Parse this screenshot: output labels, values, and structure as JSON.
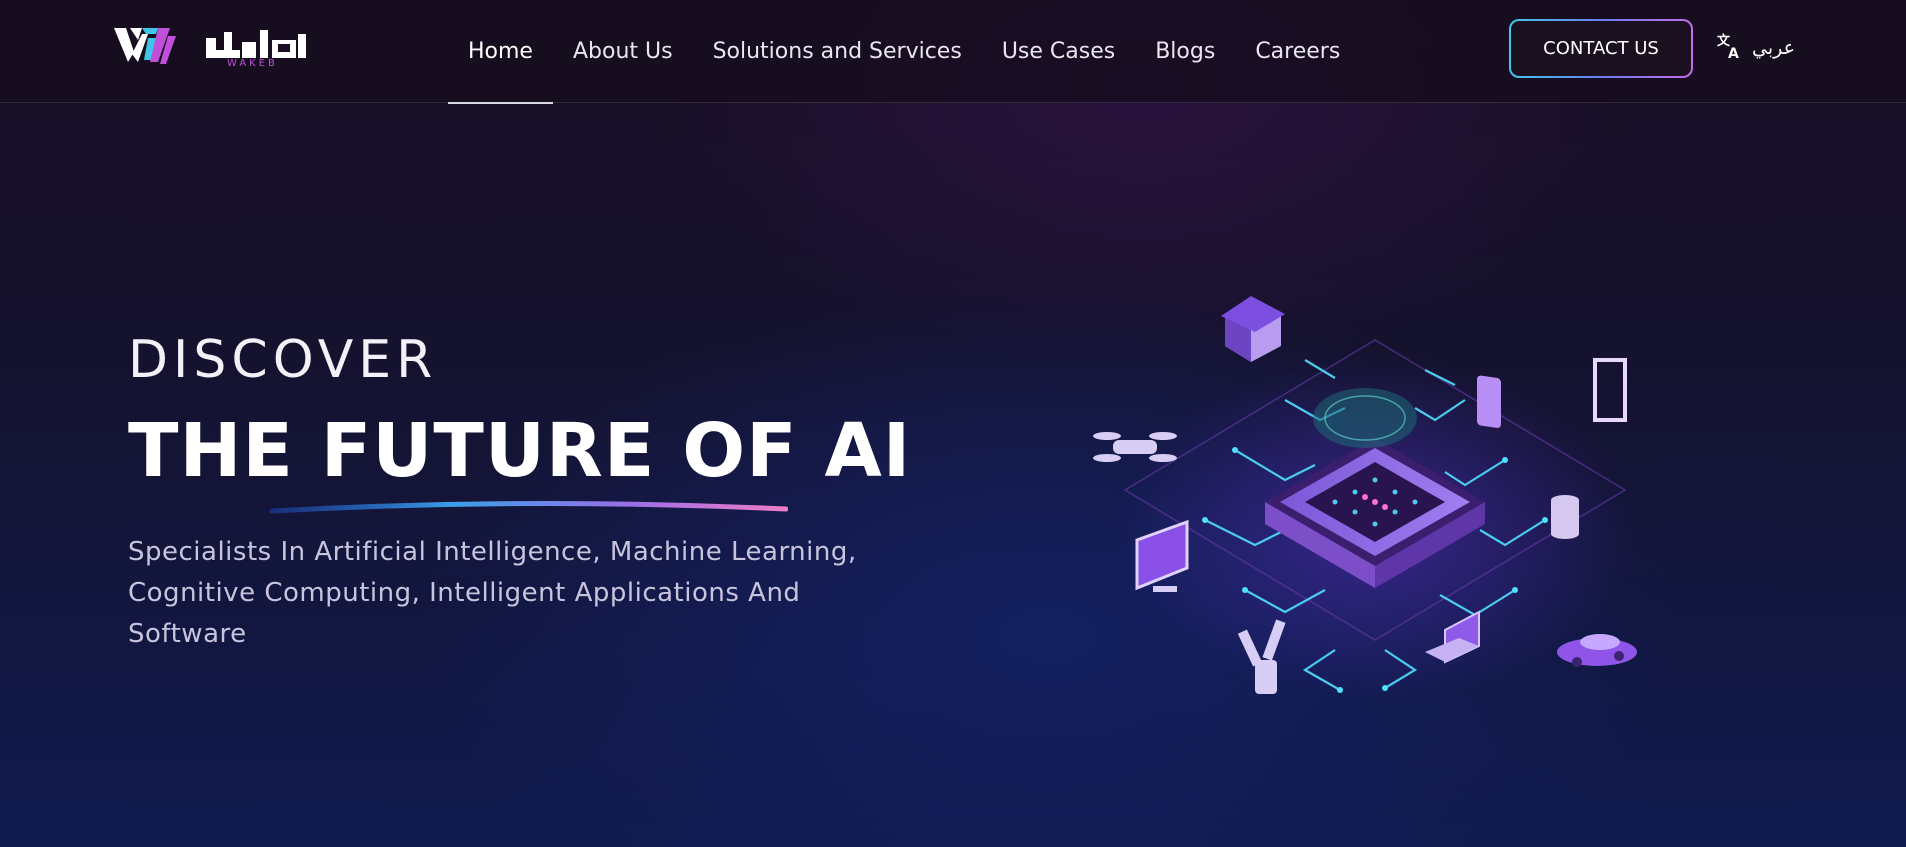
{
  "brand": {
    "logo_word": "WAKEB",
    "logo_arabic": "واكب"
  },
  "nav": {
    "items": [
      {
        "label": "Home",
        "active": true
      },
      {
        "label": "About Us",
        "active": false
      },
      {
        "label": "Solutions and Services",
        "active": false
      },
      {
        "label": "Use Cases",
        "active": false
      },
      {
        "label": "Blogs",
        "active": false
      },
      {
        "label": "Careers",
        "active": false
      }
    ],
    "contact_label": "CONTACT US",
    "language_label": "عربي",
    "language_icon": "translate-icon"
  },
  "hero": {
    "kicker": "DISCOVER",
    "title": "THE FUTURE OF AI",
    "subtitle": "Specialists In Artificial Intelligence, Machine Learning, Cognitive Computing, Intelligent Applications And Software",
    "illustration": "ai-chip-network-illustration"
  },
  "colors": {
    "accent_cyan": "#40c9e8",
    "accent_purple": "#c56ce8",
    "accent_pink": "#e070c8"
  }
}
